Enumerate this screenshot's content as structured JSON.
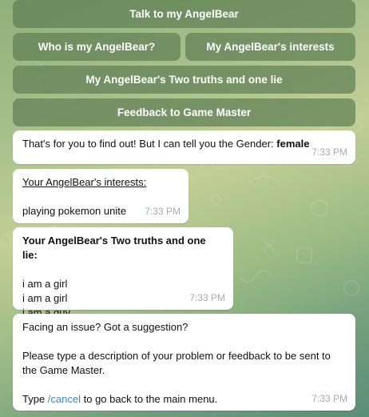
{
  "keyboard": {
    "talk": "Talk to my AngelBear",
    "who": "Who is my AngelBear?",
    "interests": "My AngelBear's interests",
    "truths": "My AngelBear's Two truths and one lie",
    "feedback": "Feedback to Game Master"
  },
  "messages": {
    "gender": {
      "text": "That's for you to find out! But I can tell you the Gender: ",
      "gender_value": "female",
      "time": "7:33 PM"
    },
    "interests": {
      "heading": "Your AngelBear's interests:",
      "value": "playing pokemon unite",
      "time": "7:33 PM"
    },
    "truths": {
      "heading": "Your AngelBear's Two truths and one lie:",
      "items": [
        "i am a girl",
        "i am a girl",
        "i am a guy"
      ],
      "time": "7:33 PM"
    },
    "feedback": {
      "line1": "Facing an issue? Got a suggestion?",
      "line2": "Please type a description of your problem or feedback to be sent to the Game Master.",
      "line3_prefix": "Type ",
      "command": "/cancel",
      "line3_suffix": " to go back to the main menu.",
      "time": "7:33 PM"
    }
  },
  "colors": {
    "button_bg": "#5f8054",
    "link": "#3a8cc5",
    "timestamp": "#a3adb3"
  }
}
